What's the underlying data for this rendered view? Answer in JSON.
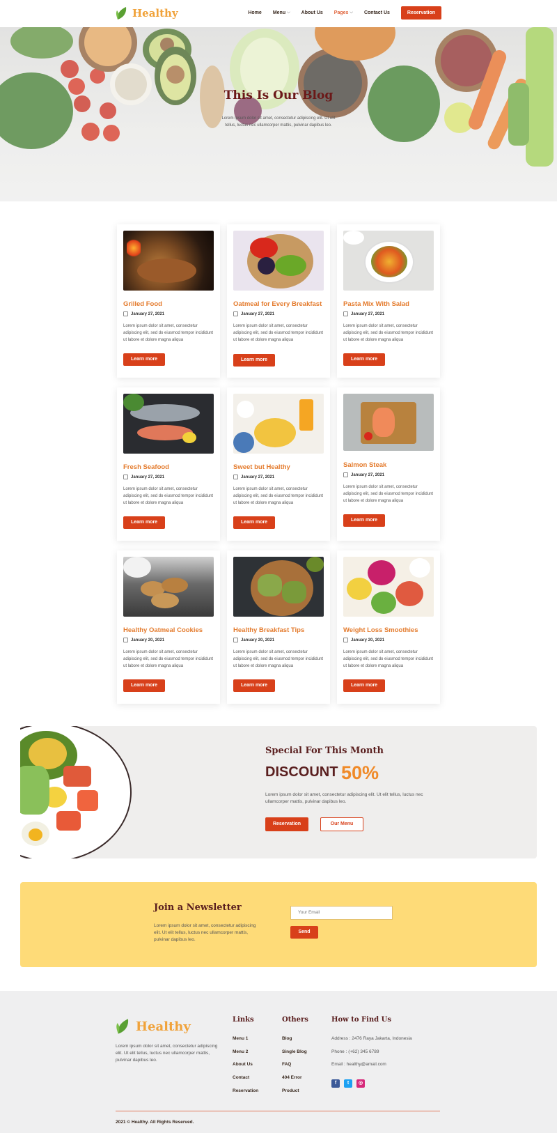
{
  "brand": {
    "name": "Healthy",
    "leaf_color": "#5aa033",
    "accent": "#d8401a",
    "title_color": "#e47b2d"
  },
  "nav": {
    "items": [
      {
        "label": "Home",
        "dropdown": false,
        "active": false
      },
      {
        "label": "Menu",
        "dropdown": true,
        "active": false
      },
      {
        "label": "About Us",
        "dropdown": false,
        "active": false
      },
      {
        "label": "Pages",
        "dropdown": true,
        "active": true
      },
      {
        "label": "Contact Us",
        "dropdown": false,
        "active": false
      }
    ],
    "cta": "Reservation"
  },
  "hero": {
    "title": "This Is Our Blog",
    "subtitle": "Lorem ipsum dolor sit amet, consectetur adipiscing elit. Ut elit tellus, luctus nec ullamcorper mattis, pulvinar dapibus leo."
  },
  "posts": [
    {
      "title": "Grilled Food",
      "date": "January 27, 2021",
      "text": "Lorem ipsum dolor sit amet, consectetur adipiscing elit, sed do eiusmod tempor incididunt ut labore et dolore magna aliqua",
      "button": "Learn more",
      "image": "grilled-chicken"
    },
    {
      "title": "Oatmeal for Every Breakfast",
      "date": "January 27, 2021",
      "text": "Lorem ipsum dolor sit amet, consectetur adipiscing elit, sed do eiusmod tempor incididunt ut labore et dolore magna aliqua",
      "button": "Learn more",
      "image": "oatmeal-bowl"
    },
    {
      "title": "Pasta Mix With Salad",
      "date": "January 27, 2021",
      "text": "Lorem ipsum dolor sit amet, consectetur adipiscing elit, sed do eiusmod tempor incididunt ut labore et dolore magna aliqua",
      "button": "Learn more",
      "image": "pasta-salad"
    },
    {
      "title": "Fresh Seafood",
      "date": "January 27, 2021",
      "text": "Lorem ipsum dolor sit amet, consectetur adipiscing elit, sed do eiusmod tempor incididunt ut labore et dolore magna aliqua",
      "button": "Learn more",
      "image": "seafood"
    },
    {
      "title": "Sweet but Healthy",
      "date": "January 27, 2021",
      "text": "Lorem ipsum dolor sit amet, consectetur adipiscing elit, sed do eiusmod tempor incididunt ut labore et dolore magna aliqua",
      "button": "Learn more",
      "image": "breakfast-table"
    },
    {
      "title": "Salmon Steak",
      "date": "January 27, 2021",
      "text": "Lorem ipsum dolor sit amet, consectetur adipiscing elit, sed do eiusmod tempor incididunt ut labore et dolore magna aliqua",
      "button": "Learn more",
      "image": "salmon-steak"
    },
    {
      "title": "Healthy Oatmeal Cookies",
      "date": "January 20, 2021",
      "text": "Lorem ipsum dolor sit amet, consectetur adipiscing elit, sed do eiusmod tempor incididunt ut labore et dolore magna aliqua",
      "button": "Learn more",
      "image": "oatmeal-cookies"
    },
    {
      "title": "Healthy Breakfast Tips",
      "date": "January 20, 2021",
      "text": "Lorem ipsum dolor sit amet, consectetur adipiscing elit, sed do eiusmod tempor incididunt ut labore et dolore magna aliqua",
      "button": "Learn more",
      "image": "avocado-toast"
    },
    {
      "title": "Weight Loss Smoothies",
      "date": "January 20, 2021",
      "text": "Lorem ipsum dolor sit amet, consectetur adipiscing elit, sed do eiusmod tempor incididunt ut labore et dolore magna aliqua",
      "button": "Learn more",
      "image": "smoothie-bowls"
    }
  ],
  "discount": {
    "eyebrow": "Special For This Month",
    "label": "DISCOUNT",
    "percent": "50%",
    "text": "Lorem ipsum dolor sit amet, consectetur adipiscing elit. Ut elit tellus, luctus nec ullamcorper mattis, pulvinar dapibus leo.",
    "primary_button": "Reservation",
    "secondary_button": "Our Menu"
  },
  "newsletter": {
    "title": "Join a Newsletter",
    "text": "Lorem ipsum dolor sit amet, consectetur adipiscing elit. Ut elit tellus, luctus nec ullamcorper mattis, pulvinar dapibus leo.",
    "placeholder": "Your Email",
    "button": "Send"
  },
  "footer": {
    "about": "Lorem ipsum dolor sit amet, consectetur adipiscing elit. Ut elit tellus, luctus nec ullamcorper mattis, pulvinar dapibus leo.",
    "links_title": "Links",
    "links": [
      "Menu 1",
      "Menu 2",
      "About Us",
      "Contact",
      "Reservation"
    ],
    "others_title": "Others",
    "others": [
      "Blog",
      "Single Blog",
      "FAQ",
      "404 Error",
      "Product"
    ],
    "find_title": "How to Find Us",
    "address": "Address : 2476 Raya Jakarta, Indonesia",
    "phone": "Phone : (+62) 345 6789",
    "email": "Email : healthy@amail.com",
    "socials": [
      {
        "name": "facebook-icon",
        "glyph": "f",
        "color": "#3b5998"
      },
      {
        "name": "twitter-icon",
        "glyph": "t",
        "color": "#1da1f2"
      },
      {
        "name": "instagram-icon",
        "glyph": "◎",
        "color": "#d6297a"
      }
    ],
    "copyright": "2021 © Healthy. All Rights Reserved."
  }
}
